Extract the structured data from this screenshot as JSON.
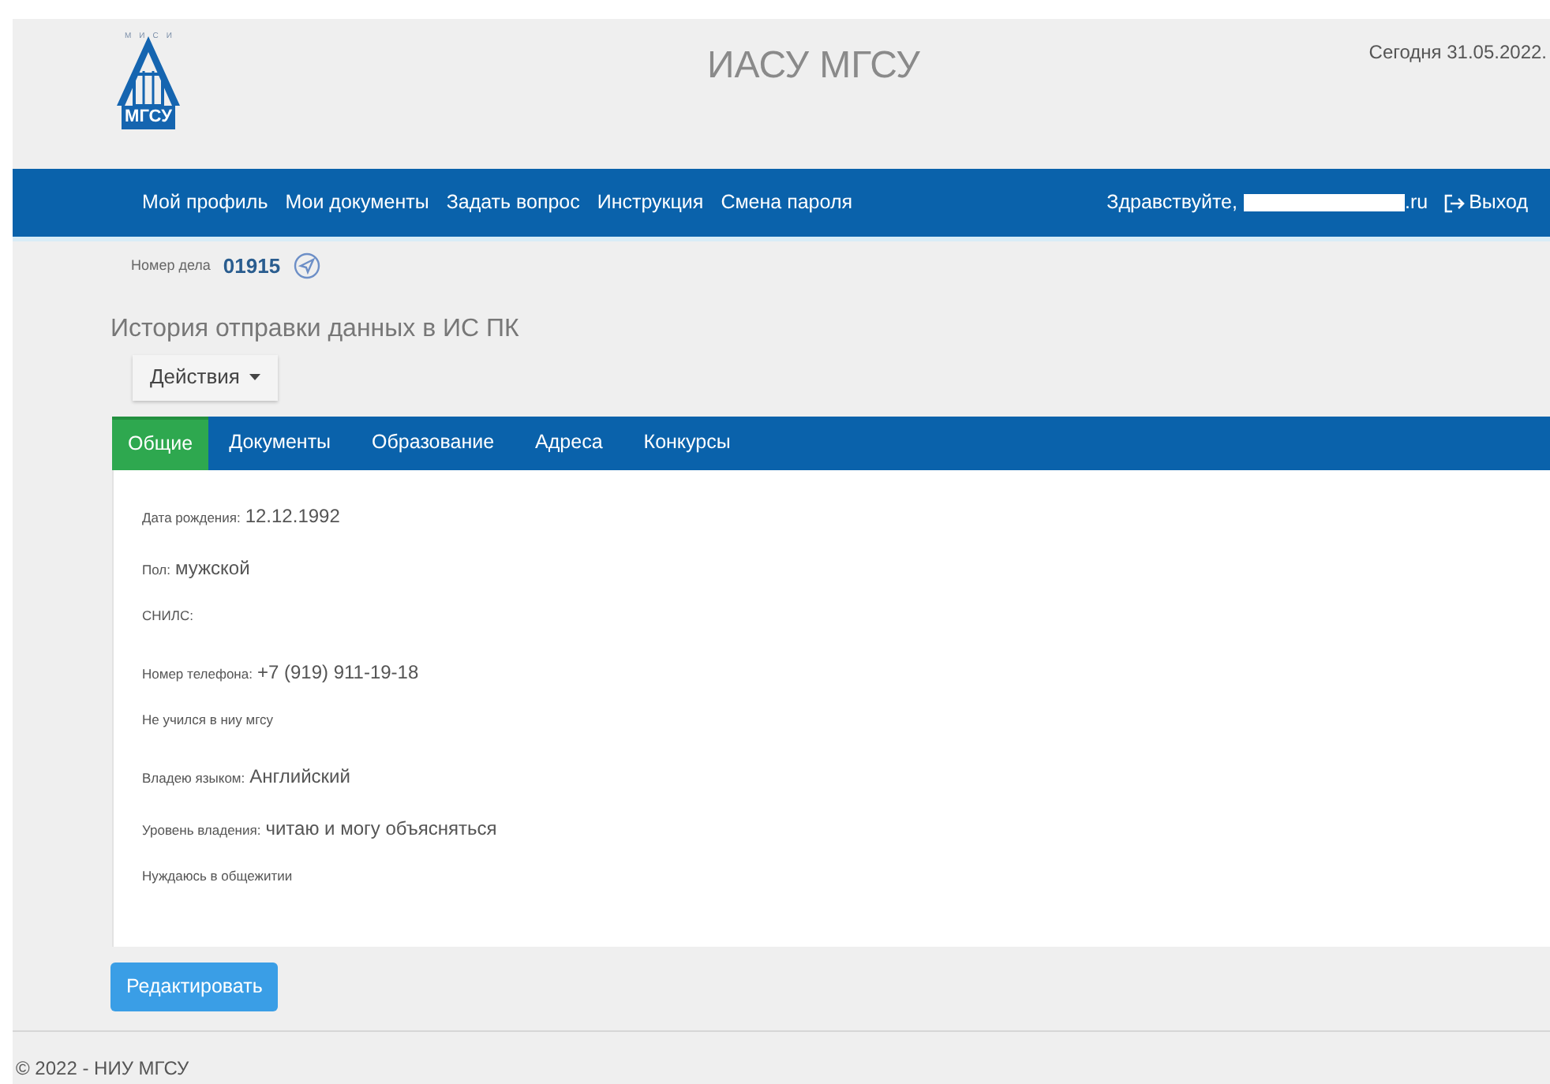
{
  "logo": {
    "top_letters": [
      "М",
      "И",
      "С",
      "И"
    ],
    "name": "МГСУ"
  },
  "header": {
    "title": "ИАСУ МГСУ",
    "today": "Сегодня 31.05.2022."
  },
  "nav": {
    "items": [
      "Мой профиль",
      "Мои документы",
      "Задать вопрос",
      "Инструкция",
      "Смена пароля"
    ],
    "greeting": "Здравствуйте,",
    "email_visible": ".ru",
    "logout": "Выход"
  },
  "case": {
    "label": "Номер дела",
    "number": "01915"
  },
  "page_title": "История отправки данных в ИС ПК",
  "actions_button": "Действия",
  "tabs": [
    {
      "label": "Общие",
      "selected": true
    },
    {
      "label": "Документы",
      "selected": false
    },
    {
      "label": "Образование",
      "selected": false
    },
    {
      "label": "Адреса",
      "selected": false
    },
    {
      "label": "Конкурсы",
      "selected": false
    }
  ],
  "fields": [
    {
      "label": "Дата рождения:",
      "value": "12.12.1992"
    },
    {
      "label": "Пол:",
      "value": "мужской"
    },
    {
      "label": "СНИЛС:"
    },
    {
      "label": "Номер телефона:",
      "value": "+7 (919) 911-19-18"
    },
    {
      "label": "Не учился в ниу мгсу"
    },
    {
      "label": "Владею языком:",
      "value": "Английский"
    },
    {
      "label": "Уровень владения:",
      "value": "читаю и могу объясняться"
    },
    {
      "label": "Нуждаюсь в общежитии"
    }
  ],
  "edit_button": "Редактировать",
  "footer": "© 2022 - НИУ МГСУ"
}
